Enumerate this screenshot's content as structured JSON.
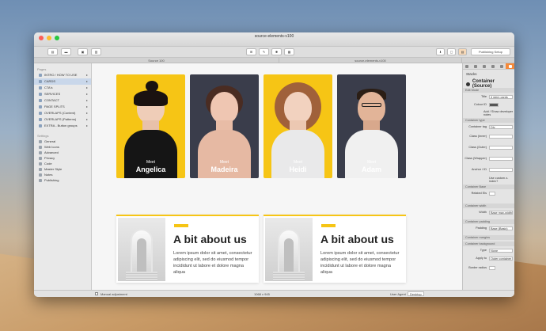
{
  "window": {
    "title": "source-elements-v100"
  },
  "toolbar": {
    "publishing_setup": "Publishing Setup"
  },
  "tabs": {
    "left": "Source 100",
    "center": "source-elements-v100",
    "right": ""
  },
  "sidebar": {
    "pages_title": "Pages",
    "pages": [
      {
        "label": "INTRO / HOW TO USE",
        "selected": false
      },
      {
        "label": "CARDS",
        "selected": true
      },
      {
        "label": "CTA's",
        "selected": false
      },
      {
        "label": "SERVICES",
        "selected": false
      },
      {
        "label": "CONTACT",
        "selected": false
      },
      {
        "label": "PAGE SPLITS",
        "selected": false
      },
      {
        "label": "OVERLAPS (Content)",
        "selected": false
      },
      {
        "label": "OVERLAPS (Patterns)",
        "selected": false
      },
      {
        "label": "EXTRA - Button groups",
        "selected": false
      }
    ],
    "settings_title": "Settings",
    "settings": [
      "General",
      "Web Icons",
      "Advanced",
      "Privacy",
      "Code",
      "Master Style",
      "Notes",
      "Publishing"
    ]
  },
  "cards": [
    {
      "meet": "Meet",
      "name": "Angelica",
      "style": "yellow"
    },
    {
      "meet": "Meet",
      "name": "Madeira",
      "style": "dark"
    },
    {
      "meet": "Meet",
      "name": "Heidi",
      "style": "yellow"
    },
    {
      "meet": "Meet",
      "name": "Adam",
      "style": "dark"
    }
  ],
  "about": [
    {
      "heading": "A bit about us",
      "body": "Lorem ipsum dolor sit amet, consectetur adipiscing elit, sed do eiusmod tempor incididunt ut labore et dolore magna aliqua"
    },
    {
      "heading": "A bit about us",
      "body": "Lorem ipsum dolor sit amet, consectetur adipiscing elit, sed do eiusmod tempor incididunt ut labore et dolore magna aliqua"
    }
  ],
  "inspector": {
    "stacks": "Stacks",
    "title": "Container (Source)",
    "edit_mode": "Edit Mode",
    "title_label": "Title",
    "title_value": "4 stem cards",
    "colour_label": "Colour ID",
    "dev_notes": "Add / Show developer notes",
    "container_type": "Container type",
    "tag_label": "Container tag",
    "tag_value": "Div",
    "class_inner": "Class (Inner)",
    "class_outer": "Class (Outer)",
    "class_wrapper": "Class (Wrapper)",
    "anchor_id": "Anchor / ID",
    "custom_zindex": "Use custom z-index?",
    "container_base": "Container Base",
    "related_els": "Related Els",
    "container_width": "Container width",
    "width_label": "Width",
    "width_value": "Base max-width",
    "container_padding": "Container padding",
    "padding_label": "Padding",
    "padding_value": "Base (Basic)",
    "container_margins": "Container margins",
    "container_background": "Container background",
    "type_label": "Type",
    "type_value": "None",
    "apply_label": "Apply to",
    "apply_value": "Outer container",
    "border_radius": "Border radius"
  },
  "status": {
    "manual": "Manual adjustment",
    "size": "1068 x 945",
    "user_agent": "User Agent",
    "ua_value": "Desktop"
  },
  "colors": {
    "accent": "#f6c515",
    "dark_card": "#3a3d4b",
    "inspector_accent": "#f58a3a"
  }
}
